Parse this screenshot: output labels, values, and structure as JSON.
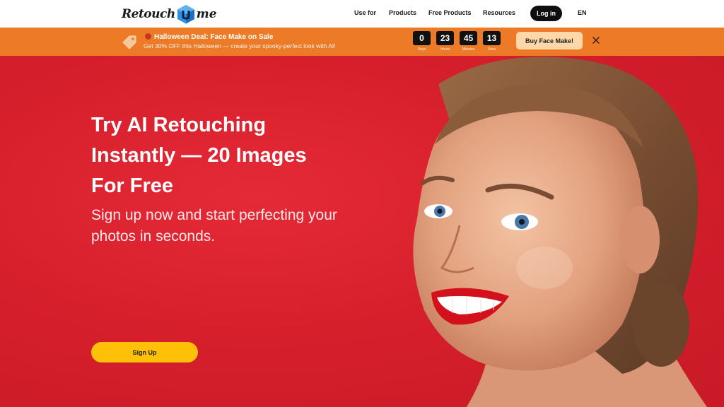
{
  "header": {
    "logo_left": "Retouch",
    "logo_right": "me",
    "nav": {
      "use_for": "Use for",
      "products": "Products",
      "free_products": "Free Products",
      "resources": "Resources"
    },
    "login_label": "Log in",
    "language": "EN"
  },
  "promo": {
    "title": "Halloween Deal: Face Make on Sale",
    "subtitle": "Get 30% OFF this Halloween — create your spooky-perfect look with AI!",
    "countdown": {
      "days": "0",
      "days_label": "Days",
      "hours": "23",
      "hours_label": "Hours",
      "minutes": "45",
      "minutes_label": "Minutes",
      "secs": "13",
      "secs_label": "Secs"
    },
    "button_label": "Buy Face Make!",
    "accent_color": "#ec7a27"
  },
  "hero": {
    "title_line1": "Try AI Retouching",
    "title_line2": "Instantly — 20 Images",
    "title_line3": "For Free",
    "subtitle_line1": "Sign up now and start perfecting your",
    "subtitle_line2": "photos in seconds.",
    "signup_label": "Sign Up",
    "background_color": "#d71f2c",
    "button_color": "#ffc107"
  }
}
